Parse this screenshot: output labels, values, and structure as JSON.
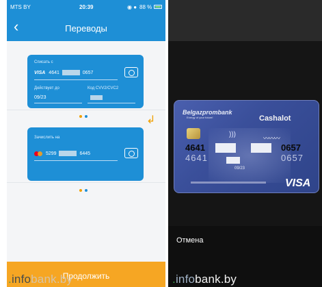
{
  "status_bar": {
    "carrier": "MTS BY",
    "time": "20:39",
    "battery": "88 %"
  },
  "nav": {
    "back_icon": "chevron-left-icon",
    "title": "Переводы"
  },
  "from_card": {
    "label": "Списать с",
    "brand": "VISA",
    "pan_start": "4641",
    "pan_end": "0657",
    "expiry_label": "Действует до",
    "expiry_value": "09/23",
    "cvv_label": "Код CVV2/CVC2",
    "camera_icon": "camera-icon"
  },
  "to_card": {
    "label": "Зачислить на",
    "brand_icon": "mastercard-icon",
    "pan_start": "5299",
    "pan_end": "6445",
    "camera_icon": "camera-icon"
  },
  "continue_label": "Продолжить",
  "watermark": {
    "prefix": ".",
    "part1": "info",
    "part2": "bank.by"
  },
  "scanner": {
    "card_brand_text": "Belgazprombank",
    "card_tagline": "Energy of your future!",
    "card_product": "Cashalot",
    "card_pan_start": "4641",
    "card_pan_end": "0657",
    "card_embossed_start": "4641",
    "card_embossed_end": "0657",
    "card_expiry": "09/23",
    "card_network": "VISA",
    "cancel_label": "Отмена"
  },
  "colors": {
    "primary": "#1e8fd6",
    "accent": "#f6a623",
    "card_blue": "#3a4f9a"
  }
}
